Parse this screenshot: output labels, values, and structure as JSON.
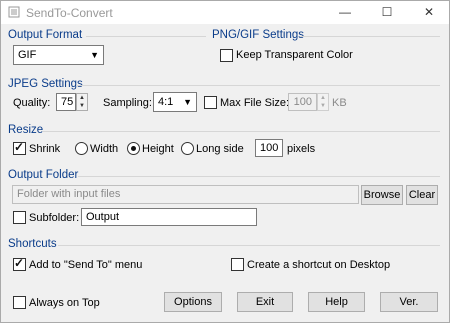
{
  "window": {
    "title": "SendTo-Convert",
    "minimize": "—",
    "maximize": "☐",
    "close": "✕"
  },
  "output_format": {
    "title": "Output Format",
    "selected": "GIF"
  },
  "png_gif": {
    "title": "PNG/GIF Settings",
    "keep_transparent_label": "Keep Transparent Color",
    "keep_transparent": false
  },
  "jpeg": {
    "title": "JPEG Settings",
    "quality_label": "Quality:",
    "quality": "75",
    "sampling_label": "Sampling:",
    "sampling": "4:1",
    "max_file_size_label": "Max File Size:",
    "max_file_size": "100",
    "max_file_size_enabled": false,
    "unit": "KB"
  },
  "resize": {
    "title": "Resize",
    "shrink_label": "Shrink",
    "shrink": true,
    "width_label": "Width",
    "height_label": "Height",
    "long_side_label": "Long side",
    "selected": "height",
    "pixels": "100",
    "pixels_unit": "pixels"
  },
  "output_folder": {
    "title": "Output Folder",
    "placeholder": "Folder with input files",
    "browse_label": "Browse",
    "clear_label": "Clear",
    "subfolder_label": "Subfolder:",
    "subfolder": false,
    "subfolder_value": "Output"
  },
  "shortcuts": {
    "title": "Shortcuts",
    "sendto_label": "Add to \"Send To\" menu",
    "sendto": true,
    "desktop_label": "Create a shortcut on Desktop",
    "desktop": false
  },
  "footer": {
    "always_on_top_label": "Always on Top",
    "always_on_top": false,
    "options_label": "Options",
    "exit_label": "Exit",
    "help_label": "Help",
    "ver_label": "Ver."
  }
}
